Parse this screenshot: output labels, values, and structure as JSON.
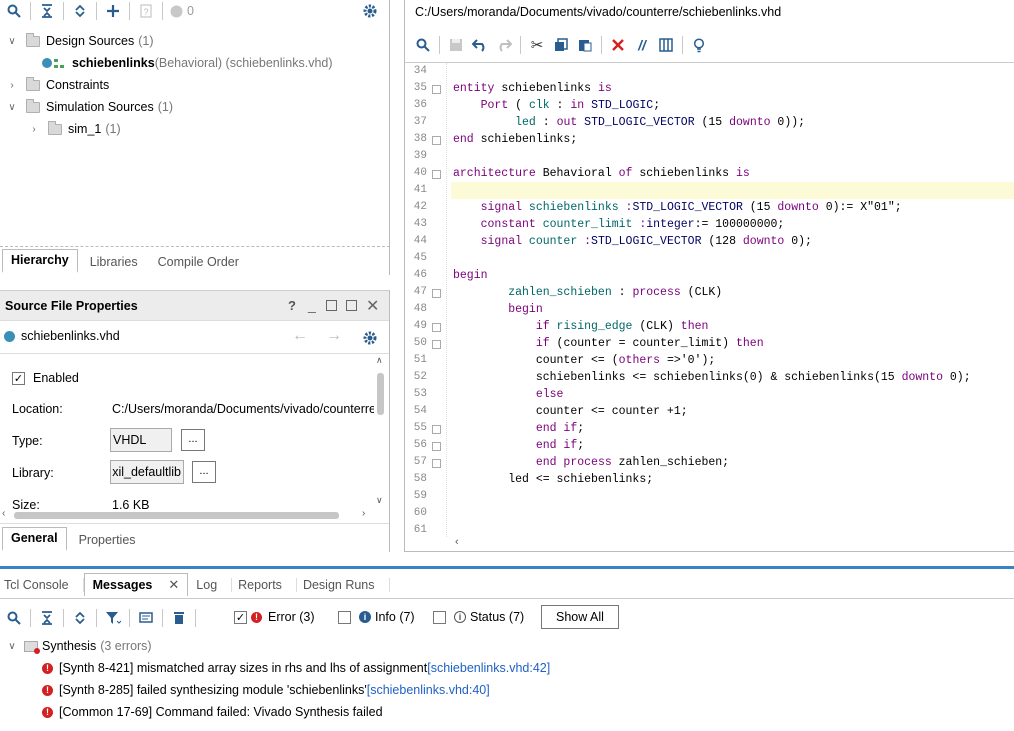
{
  "hierarchy_panel": {
    "status_count": "0",
    "tree": [
      {
        "label": "Design Sources",
        "count": "(1)"
      },
      {
        "label": "schiebenlinks",
        "detail": "(Behavioral) (schiebenlinks.vhd)"
      },
      {
        "label": "Constraints"
      },
      {
        "label": "Simulation Sources",
        "count": "(1)"
      },
      {
        "label": "sim_1",
        "count": "(1)"
      }
    ],
    "tabs": [
      "Hierarchy",
      "Libraries",
      "Compile Order"
    ]
  },
  "source_props": {
    "title": "Source File Properties",
    "help": "?",
    "file_name": "schiebenlinks.vhd",
    "enabled_label": "Enabled",
    "location_label": "Location:",
    "location_value": "C:/Users/moranda/Documents/vivado/counterre",
    "type_label": "Type:",
    "type_value": "VHDL",
    "library_label": "Library:",
    "library_value": "xil_defaultlib",
    "size_label": "Size:",
    "size_value": "1.6 KB",
    "dots": "...",
    "tabs": [
      "General",
      "Properties"
    ]
  },
  "editor": {
    "path": "C:/Users/moranda/Documents/vivado/counterre/schiebenlinks.vhd",
    "line_numbers": [
      "34",
      "35",
      "36",
      "37",
      "38",
      "39",
      "40",
      "41",
      "42",
      "43",
      "44",
      "45",
      "46",
      "47",
      "48",
      "49",
      "50",
      "51",
      "52",
      "53",
      "54",
      "55",
      "56",
      "57",
      "58",
      "59",
      "60",
      "61"
    ],
    "lines": [
      [],
      [
        [
          "kw",
          "entity "
        ],
        [
          "nm",
          "schiebenlinks "
        ],
        [
          "kw",
          "is"
        ]
      ],
      [
        [
          "nm",
          "    "
        ],
        [
          "kw",
          "Port"
        ],
        [
          "nm",
          " ( "
        ],
        [
          "id",
          "clk"
        ],
        [
          "nm",
          " : "
        ],
        [
          "kw",
          "in "
        ],
        [
          "ty",
          "STD_LOGIC"
        ],
        [
          "nm",
          ";"
        ]
      ],
      [
        [
          "nm",
          "         "
        ],
        [
          "id",
          "led"
        ],
        [
          "nm",
          " : "
        ],
        [
          "kw",
          "out "
        ],
        [
          "ty",
          "STD_LOGIC_VECTOR"
        ],
        [
          "nm",
          " (15 "
        ],
        [
          "kw",
          "downto"
        ],
        [
          "nm",
          " 0));"
        ]
      ],
      [
        [
          "kw",
          "end "
        ],
        [
          "nm",
          "schiebenlinks;"
        ]
      ],
      [],
      [
        [
          "kw",
          "architecture "
        ],
        [
          "nm",
          "Behavioral "
        ],
        [
          "kw",
          "of "
        ],
        [
          "nm",
          "schiebenlinks "
        ],
        [
          "kw",
          "is"
        ]
      ],
      [],
      [
        [
          "nm",
          "    "
        ],
        [
          "kw",
          "signal "
        ],
        [
          "id",
          "schiebenlinks "
        ],
        [
          "kw",
          ":"
        ],
        [
          "ty",
          "STD_LOGIC_VECTOR"
        ],
        [
          "nm",
          " (15 "
        ],
        [
          "kw",
          "downto "
        ],
        [
          "nm",
          "0):= X\"01\";"
        ]
      ],
      [
        [
          "nm",
          "    "
        ],
        [
          "kw",
          "constant "
        ],
        [
          "id",
          "counter_limit "
        ],
        [
          "kw",
          ":"
        ],
        [
          "ty",
          "integer"
        ],
        [
          "nm",
          ":= 100000000;"
        ]
      ],
      [
        [
          "nm",
          "    "
        ],
        [
          "kw",
          "signal "
        ],
        [
          "id",
          "counter "
        ],
        [
          "kw",
          ":"
        ],
        [
          "ty",
          "STD_LOGIC_VECTOR"
        ],
        [
          "nm",
          " (128 "
        ],
        [
          "kw",
          "downto"
        ],
        [
          "nm",
          " 0);"
        ]
      ],
      [],
      [
        [
          "kw",
          "begin"
        ]
      ],
      [
        [
          "nm",
          "        "
        ],
        [
          "id",
          "zahlen_schieben "
        ],
        [
          "nm",
          ": "
        ],
        [
          "kw",
          "process "
        ],
        [
          "nm",
          "(CLK)"
        ]
      ],
      [
        [
          "nm",
          "        "
        ],
        [
          "kw",
          "begin"
        ]
      ],
      [
        [
          "nm",
          "            "
        ],
        [
          "kw",
          "if "
        ],
        [
          "id",
          "rising_edge "
        ],
        [
          "nm",
          "(CLK) "
        ],
        [
          "kw",
          "then"
        ]
      ],
      [
        [
          "nm",
          "            "
        ],
        [
          "kw",
          "if "
        ],
        [
          "nm",
          "(counter = counter_limit) "
        ],
        [
          "kw",
          "then"
        ]
      ],
      [
        [
          "nm",
          "            counter <= ("
        ],
        [
          "kw",
          "others "
        ],
        [
          "nm",
          "=>'0');"
        ]
      ],
      [
        [
          "nm",
          "            schiebenlinks <= schiebenlinks(0) & schiebenlinks(15 "
        ],
        [
          "kw",
          "downto "
        ],
        [
          "nm",
          "0);"
        ]
      ],
      [
        [
          "nm",
          "            "
        ],
        [
          "kw",
          "else"
        ]
      ],
      [
        [
          "nm",
          "            counter <= counter +1;"
        ]
      ],
      [
        [
          "nm",
          "            "
        ],
        [
          "kw",
          "end if"
        ],
        [
          "nm",
          ";"
        ]
      ],
      [
        [
          "nm",
          "            "
        ],
        [
          "kw",
          "end if"
        ],
        [
          "nm",
          ";"
        ]
      ],
      [
        [
          "nm",
          "            "
        ],
        [
          "kw",
          "end process "
        ],
        [
          "nm",
          "zahlen_schieben;"
        ]
      ],
      [
        [
          "nm",
          "        led <= schiebenlinks;"
        ]
      ],
      [],
      [],
      []
    ]
  },
  "bottom": {
    "tabs": [
      "Tcl Console",
      "Messages",
      "Log",
      "Reports",
      "Design Runs"
    ],
    "filters": [
      {
        "label": "Error (3)"
      },
      {
        "label": "Info (7)"
      },
      {
        "label": "Status (7)"
      }
    ],
    "show_all": "Show All",
    "group_label": "Synthesis",
    "group_count": "(3 errors)",
    "messages": [
      {
        "text": "[Synth 8-421] mismatched array sizes in rhs and lhs of assignment ",
        "link": "[schiebenlinks.vhd:42]"
      },
      {
        "text": "[Synth 8-285] failed synthesizing module 'schiebenlinks' ",
        "link": "[schiebenlinks.vhd:40]"
      },
      {
        "text": "[Common 17-69] Command failed: Vivado Synthesis failed",
        "link": ""
      }
    ]
  },
  "colors": {
    "accent": "#2a5d8f",
    "error": "#d32020",
    "link": "#1f61c4",
    "highlight": "#fdfbd7"
  }
}
